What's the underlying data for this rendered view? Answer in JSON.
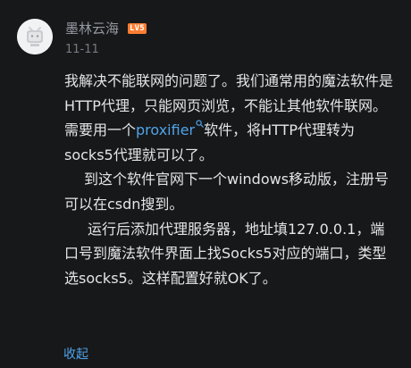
{
  "comment": {
    "username": "墨林云海",
    "level_badge": "LV5",
    "date": "11-11",
    "paragraph1_before_link": "我解决不能联网的问题了。我们通常用的魔法软件是HTTP代理，只能网页浏览，不能让其他软件联网。需要用一个",
    "link_text": "proxifier",
    "paragraph1_after_link": "软件，将HTTP代理转为socks5代理就可以了。",
    "paragraph2": "到这个软件官网下一个windows移动版，注册号可以在csdn搜到。",
    "paragraph3": "运行后添加代理服务器，地址填127.0.0.1，端口号到魔法软件界面上找Socks5对应的端口，类型选socks5。这样配置好就OK了。",
    "collapse_label": "收起"
  },
  "icons": {
    "avatar": "default-tv-avatar-icon",
    "link": "search-icon"
  },
  "colors": {
    "background": "#17181a",
    "text": "#e3e5e7",
    "meta": "#9499a0",
    "link": "#4fa4e9",
    "level_badge": "#fb7d32"
  }
}
